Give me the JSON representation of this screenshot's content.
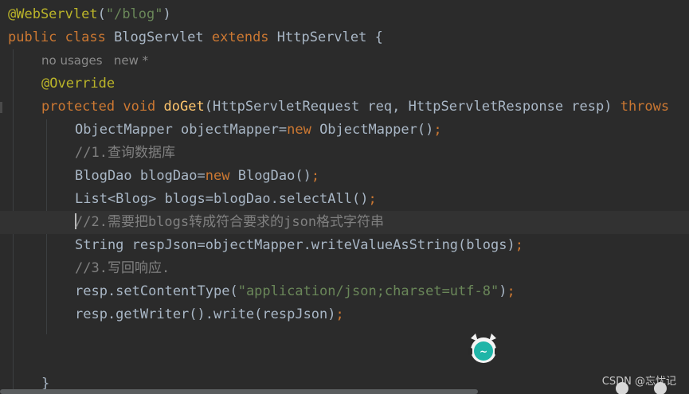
{
  "editor": {
    "lines": [
      {
        "tokens": [
          {
            "t": "@WebServlet",
            "c": "anno"
          },
          {
            "t": "(",
            "c": ""
          },
          {
            "t": "\"/blog\"",
            "c": "str"
          },
          {
            "t": ")",
            "c": ""
          }
        ]
      },
      {
        "tokens": [
          {
            "t": "public class ",
            "c": "kw"
          },
          {
            "t": "BlogServlet ",
            "c": ""
          },
          {
            "t": "extends ",
            "c": "kw"
          },
          {
            "t": "HttpServlet {",
            "c": ""
          }
        ]
      },
      {
        "tokens": [
          {
            "t": "no usages   new *",
            "c": "hint"
          }
        ]
      },
      {
        "tokens": [
          {
            "t": "@Override",
            "c": "anno"
          }
        ]
      },
      {
        "tokens": [
          {
            "t": "protected void ",
            "c": "kw"
          },
          {
            "t": "doGet",
            "c": "fn"
          },
          {
            "t": "(HttpServletRequest req, HttpServletResponse resp) ",
            "c": ""
          },
          {
            "t": "throws",
            "c": "kw"
          }
        ]
      },
      {
        "tokens": [
          {
            "t": "ObjectMapper objectMapper=",
            "c": ""
          },
          {
            "t": "new ",
            "c": "kw"
          },
          {
            "t": "ObjectMapper()",
            "c": ""
          },
          {
            "t": ";",
            "c": "kw"
          }
        ]
      },
      {
        "tokens": [
          {
            "t": "//1.查询数据库",
            "c": "cmt"
          }
        ]
      },
      {
        "tokens": [
          {
            "t": "BlogDao blogDao=",
            "c": ""
          },
          {
            "t": "new ",
            "c": "kw"
          },
          {
            "t": "BlogDao()",
            "c": ""
          },
          {
            "t": ";",
            "c": "kw"
          }
        ]
      },
      {
        "tokens": [
          {
            "t": "List<Blog> blogs=blogDao.selectAll()",
            "c": ""
          },
          {
            "t": ";",
            "c": "kw"
          }
        ]
      },
      {
        "tokens": [
          {
            "t": "//2.需要把blogs转成符合要求的json格式字符串",
            "c": "cmt"
          }
        ]
      },
      {
        "tokens": [
          {
            "t": "String respJson=objectMapper.writeValueAsString(blogs)",
            "c": ""
          },
          {
            "t": ";",
            "c": "kw"
          }
        ]
      },
      {
        "tokens": [
          {
            "t": "//3.写回响应.",
            "c": "cmt"
          }
        ]
      },
      {
        "tokens": [
          {
            "t": "resp.setContentType(",
            "c": ""
          },
          {
            "t": "\"application/json;charset=utf-8\"",
            "c": "str"
          },
          {
            "t": ")",
            "c": ""
          },
          {
            "t": ";",
            "c": "kw"
          }
        ]
      },
      {
        "tokens": [
          {
            "t": "resp.getWriter().write(respJson)",
            "c": ""
          },
          {
            "t": ";",
            "c": "kw"
          }
        ]
      },
      {
        "tokens": []
      },
      {
        "tokens": []
      },
      {
        "tokens": [
          {
            "t": "}",
            "c": ""
          }
        ]
      }
    ]
  },
  "watermark": {
    "text": "CSDN @忘忧记"
  },
  "colors": {
    "background": "#2b2b2b",
    "keyword": "#cc7832",
    "annotation": "#bbb529",
    "method": "#ffc66d",
    "string": "#6a8759",
    "comment": "#808080",
    "default": "#a9b7c6"
  },
  "icons": [
    "mascot-icon"
  ]
}
